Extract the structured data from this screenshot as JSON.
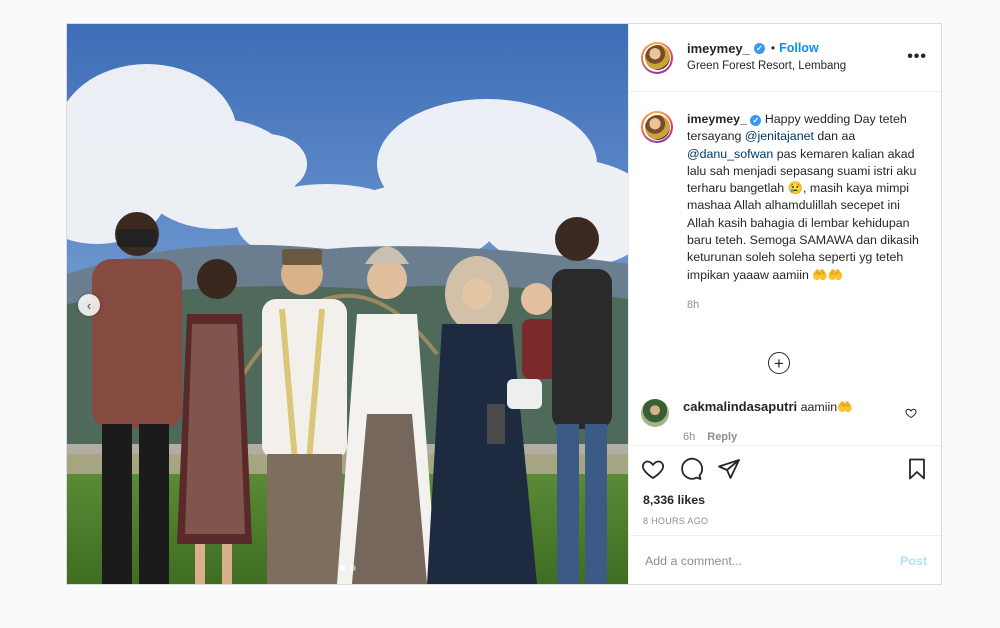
{
  "post": {
    "username": "imeymey_",
    "verified": true,
    "separator": "•",
    "follow_label": "Follow",
    "location": "Green Forest Resort, Lembang",
    "more_label": "•••"
  },
  "caption": {
    "username": "imeymey_",
    "text_1": "Happy wedding Day teteh tersayang ",
    "mention_1": "@jenitajanet",
    "text_2": " dan aa ",
    "mention_2": "@danu_sofwan",
    "text_3": " pas kemaren kalian akad lalu sah menjadi sepasang suami istri aku terharu bangetlah 😢, masih kaya mimpi mashaa Allah alhamdulillah secepet ini Allah kasih bahagia di lembar kehidupan baru teteh. Semoga SAMAWA dan dikasih keturunan soleh soleha seperti yg teteh impikan yaaaw aamiin 🤲🤲",
    "time": "8h"
  },
  "load_more_label": "+",
  "comment": {
    "username": "cakmalindasaputri",
    "text": "aamiin🤲",
    "time": "6h",
    "reply_label": "Reply"
  },
  "photo": {
    "prev_arrow": "‹",
    "dots": 2,
    "active_dot": 0
  },
  "stats": {
    "likes": "8,336 likes",
    "posted": "8 HOURS AGO"
  },
  "add_comment": {
    "placeholder": "Add a comment...",
    "post_label": "Post"
  }
}
